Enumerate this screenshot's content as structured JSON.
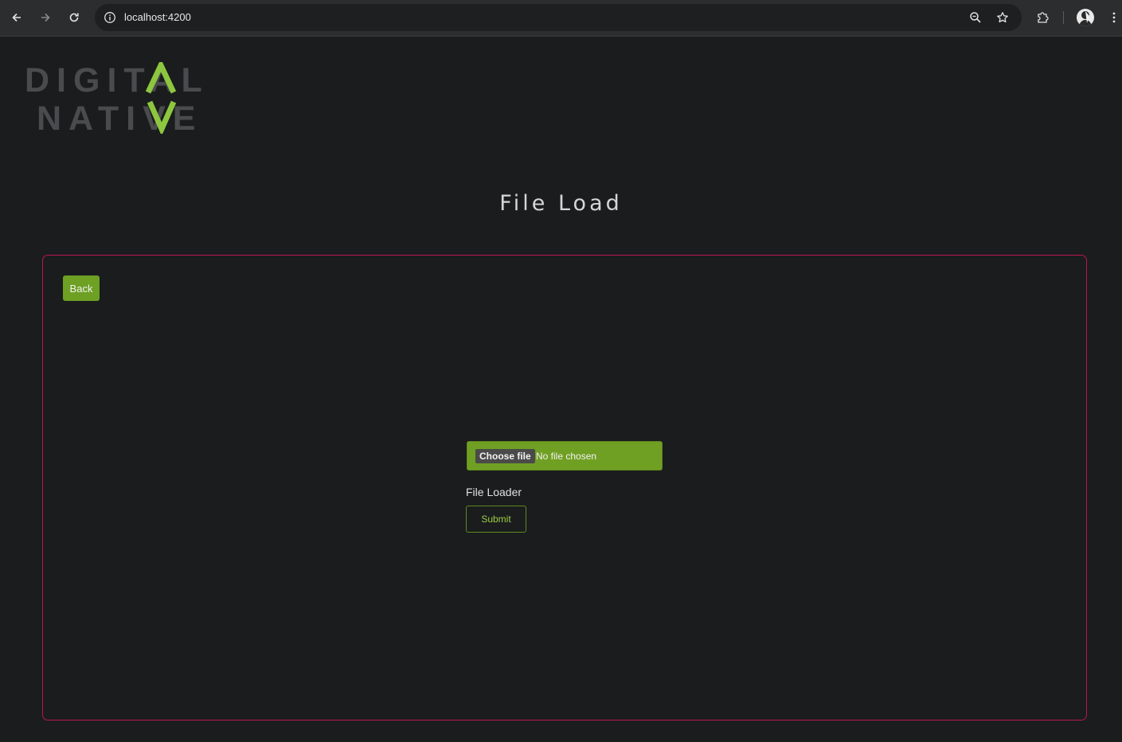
{
  "browser": {
    "url": "localhost:4200",
    "back_icon": "arrow-left-icon",
    "forward_icon": "arrow-right-icon",
    "reload_icon": "reload-icon",
    "info_icon": "info-icon",
    "zoom_icon": "zoom-icon",
    "bookmark_icon": "star-icon",
    "extensions_icon": "puzzle-icon",
    "menu_icon": "kebab-menu-icon"
  },
  "logo": {
    "line1": "DIGITAL",
    "line2": "NATIVE"
  },
  "page": {
    "title": "File Load"
  },
  "panel": {
    "back_label": "Back",
    "file_input": {
      "button_label": "Choose file",
      "status": "No file chosen"
    },
    "loader_label": "File Loader",
    "submit_label": "Submit"
  },
  "colors": {
    "background": "#1b1c1e",
    "accent_green": "#6da023",
    "logo_green": "#8dc63f",
    "logo_gray": "#4a4b4d",
    "panel_border": "#b8174f"
  }
}
